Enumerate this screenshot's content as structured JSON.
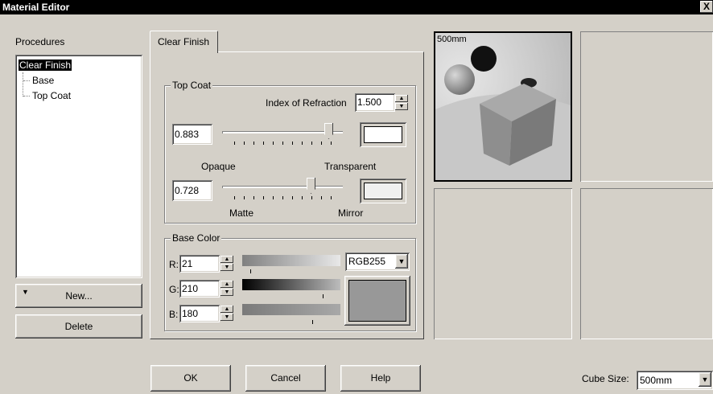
{
  "window": {
    "title": "Material Editor",
    "close": "X"
  },
  "procedures": {
    "label": "Procedures",
    "tree": {
      "root": "Clear Finish",
      "children": [
        "Base",
        "Top Coat"
      ]
    },
    "new_button": "New...",
    "delete_button": "Delete"
  },
  "tab": {
    "label": "Clear Finish"
  },
  "top_coat": {
    "group_label": "Top Coat",
    "ior_label": "Index of Refraction",
    "ior_value": "1.500",
    "opacity_value": "0.883",
    "opacity_level": 0.88,
    "opaque_label": "Opaque",
    "transparent_label": "Transparent",
    "reflect_value": "0.728",
    "reflect_level": 0.73,
    "matte_label": "Matte",
    "mirror_label": "Mirror",
    "swatch1_color": "#ffffff",
    "swatch2_color": "#f0f0f0"
  },
  "base_color": {
    "group_label": "Base Color",
    "r_label": "R:",
    "r_value": "21",
    "r_level": 0.08,
    "g_label": "G:",
    "g_value": "210",
    "g_level": 0.82,
    "b_label": "B:",
    "b_value": "180",
    "b_level": 0.71,
    "mode": "RGB255",
    "swatch_color": "#989898"
  },
  "preview": {
    "size_label": "500mm"
  },
  "buttons": {
    "ok": "OK",
    "cancel": "Cancel",
    "help": "Help"
  },
  "cube_size": {
    "label": "Cube Size:",
    "value": "500mm"
  }
}
